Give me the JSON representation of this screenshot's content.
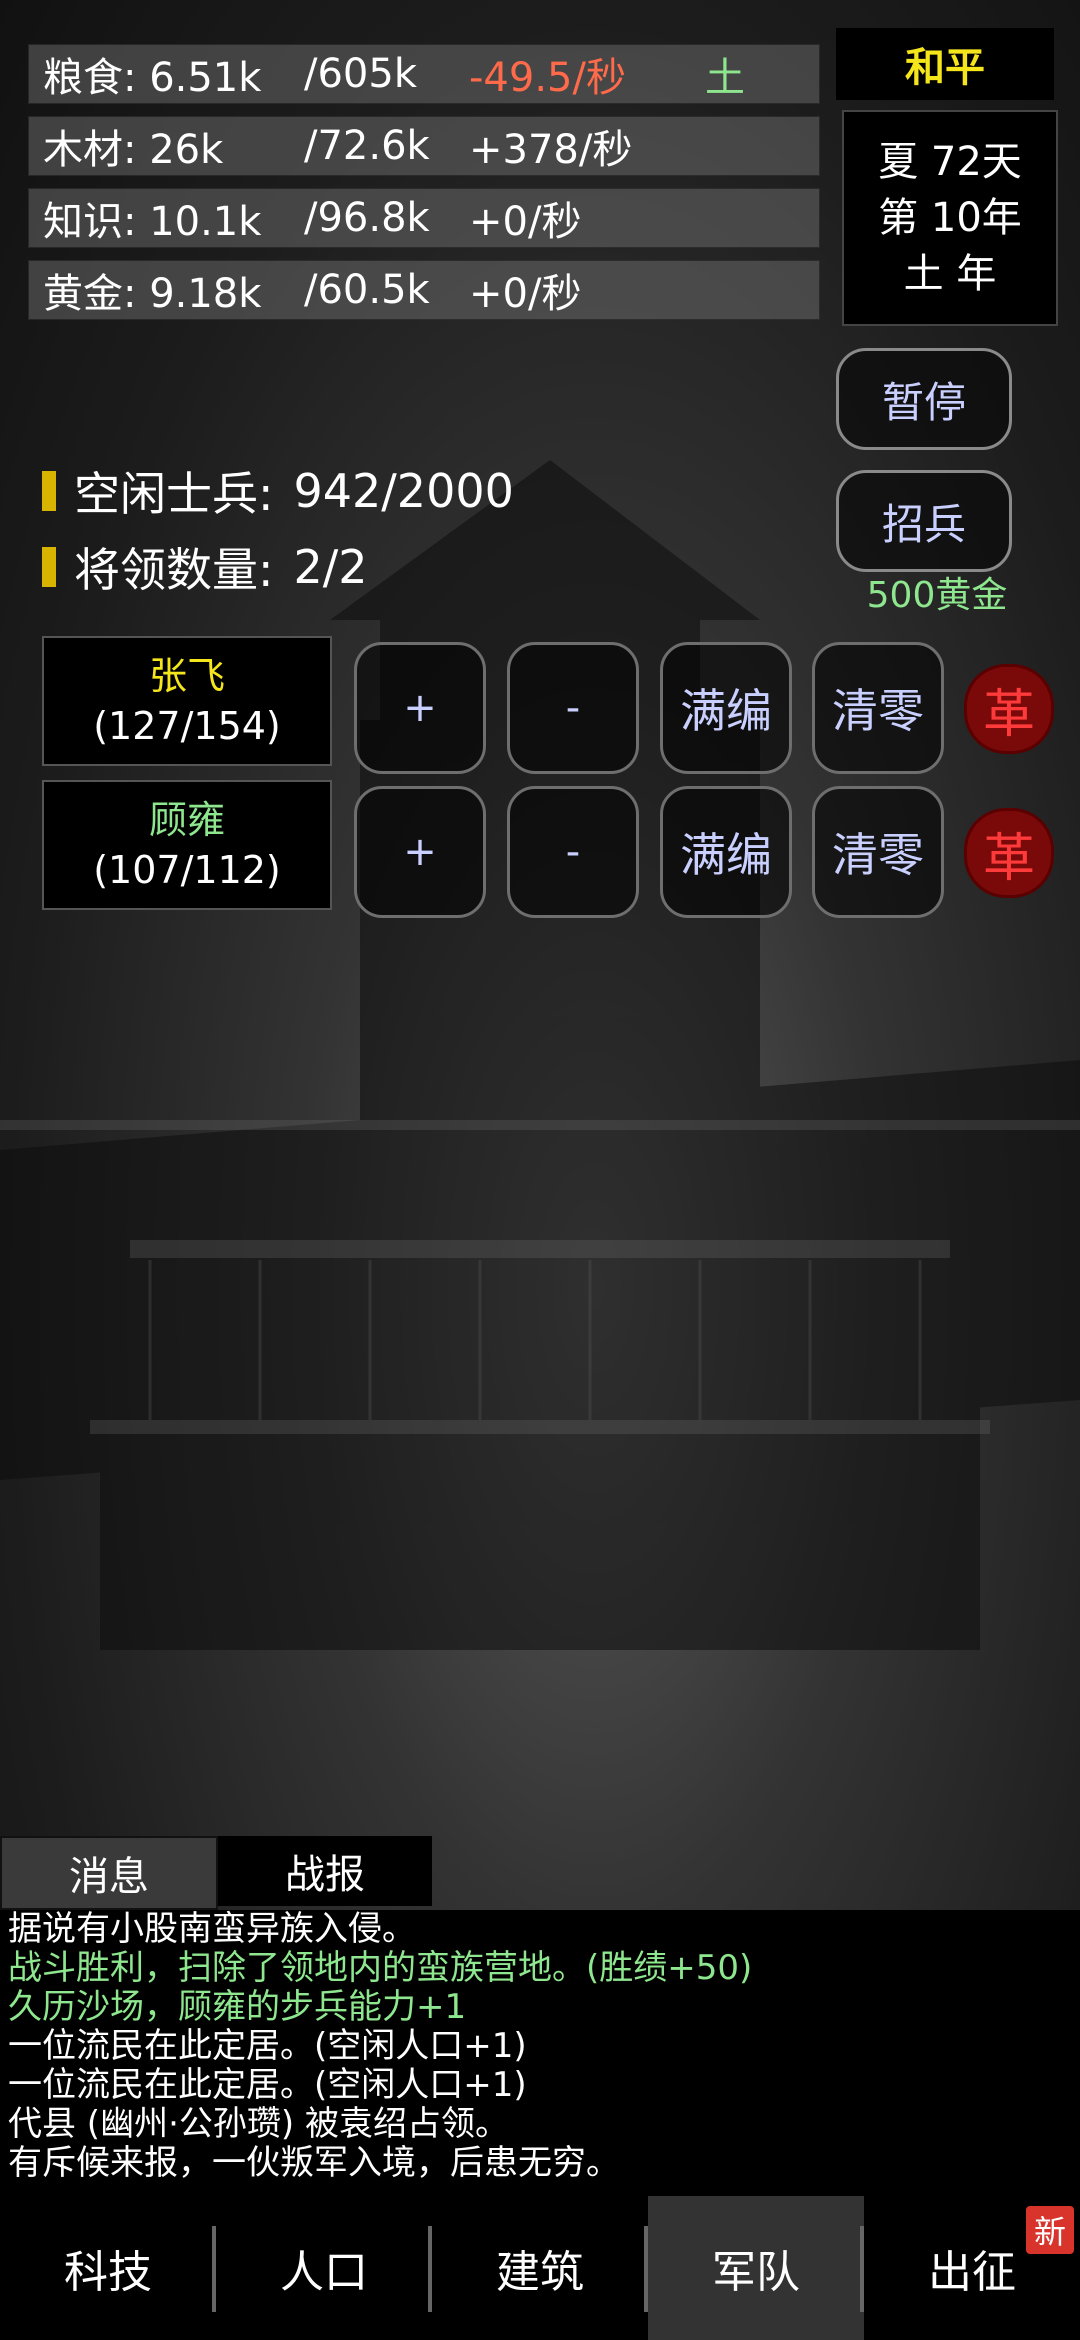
{
  "resources": [
    {
      "name": "粮食: 6.51k",
      "max": "/605k",
      "rate": "-49.5/秒",
      "rate_color": "#ff6a4a",
      "tag": "土",
      "tag_color": "#8ee68e"
    },
    {
      "name": "木材: 26k",
      "max": "/72.6k",
      "rate": "+378/秒",
      "rate_color": "#ffffff",
      "tag": "",
      "tag_color": "#8ee68e"
    },
    {
      "name": "知识: 10.1k",
      "max": "/96.8k",
      "rate": "+0/秒",
      "rate_color": "#ffffff",
      "tag": "",
      "tag_color": "#8ee68e"
    },
    {
      "name": "黄金: 9.18k",
      "max": "/60.5k",
      "rate": "+0/秒",
      "rate_color": "#ffffff",
      "tag": "",
      "tag_color": "#8ee68e"
    }
  ],
  "status": {
    "peace": "和平"
  },
  "date": {
    "season_day": "夏 72天",
    "year": "第 10年",
    "element_year": "土 年"
  },
  "buttons": {
    "pause": "暂停",
    "recruit": "招兵",
    "recruit_cost": "500黄金"
  },
  "army": {
    "idle_soldiers_label": "空闲士兵:",
    "idle_soldiers_value": "942/2000",
    "generals_label": "将领数量:",
    "generals_value": "2/2"
  },
  "generals": [
    {
      "name": "张飞",
      "count": "(127/154)",
      "plus": "+",
      "minus": "-",
      "full": "满编",
      "clear": "清零",
      "reform": "革"
    },
    {
      "name": "顾雍",
      "count": "(107/112)",
      "plus": "+",
      "minus": "-",
      "full": "满编",
      "clear": "清零",
      "reform": "革"
    }
  ],
  "log": {
    "tabs": [
      "消息",
      "战报"
    ],
    "lines": [
      {
        "text": "据说有小股南蛮异族入侵。",
        "color": "white"
      },
      {
        "text": "战斗胜利，扫除了领地内的蛮族营地。(胜绩+50)",
        "color": "green"
      },
      {
        "text": "久历沙场，顾雍的步兵能力+1",
        "color": "green"
      },
      {
        "text": "一位流民在此定居。(空闲人口+1)",
        "color": "white"
      },
      {
        "text": "一位流民在此定居。(空闲人口+1)",
        "color": "white"
      },
      {
        "text": "代县 (幽州·公孙瓒) 被袁绍占领。",
        "color": "white"
      },
      {
        "text": "有斥候来报，一伙叛军入境，后患无穷。",
        "color": "white"
      }
    ]
  },
  "nav": {
    "items": [
      "科技",
      "人口",
      "建筑",
      "军队",
      "出征"
    ],
    "active_index": 3,
    "badge": "新"
  }
}
